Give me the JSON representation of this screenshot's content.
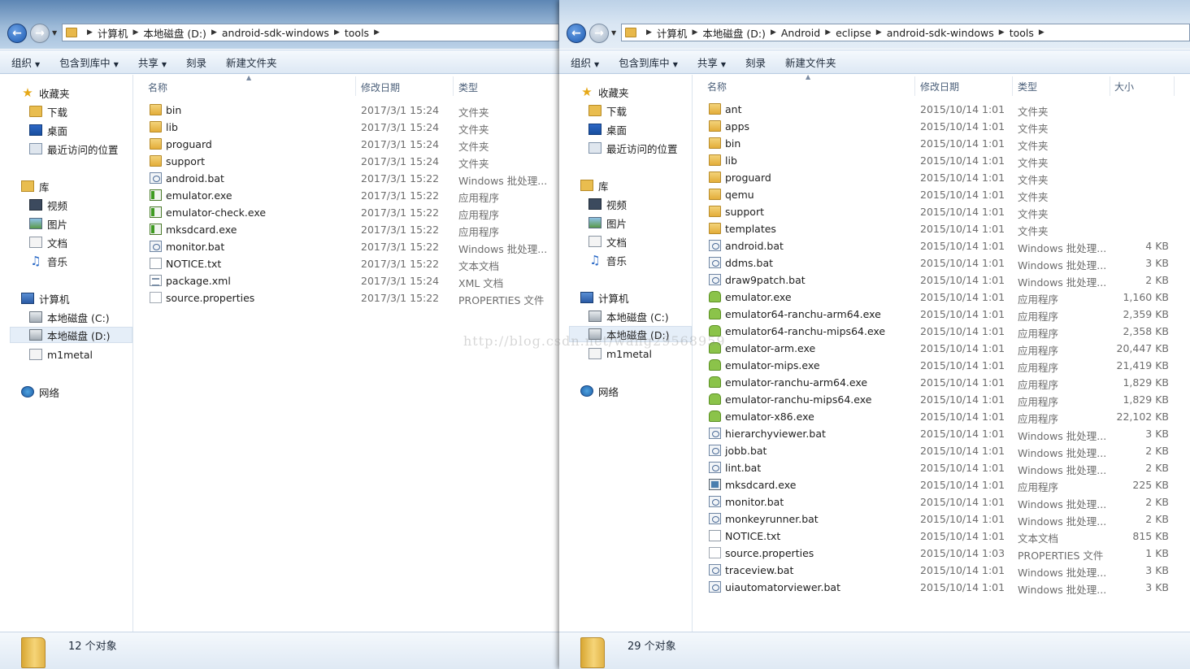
{
  "left": {
    "address": [
      "计算机",
      "本地磁盘 (D:)",
      "android-sdk-windows",
      "tools"
    ],
    "toolbar": {
      "organize": "组织",
      "include_library": "包含到库中",
      "share": "共享",
      "burn": "刻录",
      "new_folder": "新建文件夹"
    },
    "nav": {
      "favorites": "收藏夹",
      "downloads": "下载",
      "desktop": "桌面",
      "recent": "最近访问的位置",
      "libraries": "库",
      "videos": "视频",
      "pictures": "图片",
      "documents": "文档",
      "music": "音乐",
      "computer": "计算机",
      "drive_c": "本地磁盘 (C:)",
      "drive_d": "本地磁盘 (D:)",
      "m1metal": "m1metal",
      "network": "网络"
    },
    "columns": {
      "name": "名称",
      "date": "修改日期",
      "type": "类型"
    },
    "files": [
      {
        "name": "bin",
        "date": "2017/3/1 15:24",
        "type": "文件夹",
        "icon": "folder-icon"
      },
      {
        "name": "lib",
        "date": "2017/3/1 15:24",
        "type": "文件夹",
        "icon": "folder-icon"
      },
      {
        "name": "proguard",
        "date": "2017/3/1 15:24",
        "type": "文件夹",
        "icon": "folder-icon"
      },
      {
        "name": "support",
        "date": "2017/3/1 15:24",
        "type": "文件夹",
        "icon": "folder-icon"
      },
      {
        "name": "android.bat",
        "date": "2017/3/1 15:22",
        "type": "Windows 批处理...",
        "icon": "bat-file-icon"
      },
      {
        "name": "emulator.exe",
        "date": "2017/3/1 15:22",
        "type": "应用程序",
        "icon": "exe-file-icon"
      },
      {
        "name": "emulator-check.exe",
        "date": "2017/3/1 15:22",
        "type": "应用程序",
        "icon": "exe-file-icon"
      },
      {
        "name": "mksdcard.exe",
        "date": "2017/3/1 15:22",
        "type": "应用程序",
        "icon": "exe-file-icon"
      },
      {
        "name": "monitor.bat",
        "date": "2017/3/1 15:22",
        "type": "Windows 批处理...",
        "icon": "bat-file-icon"
      },
      {
        "name": "NOTICE.txt",
        "date": "2017/3/1 15:22",
        "type": "文本文档",
        "icon": "txt-file-icon"
      },
      {
        "name": "package.xml",
        "date": "2017/3/1 15:24",
        "type": "XML 文档",
        "icon": "xml-file-icon"
      },
      {
        "name": "source.properties",
        "date": "2017/3/1 15:22",
        "type": "PROPERTIES 文件",
        "icon": "properties-file-icon"
      }
    ],
    "status": "12 个对象"
  },
  "right": {
    "address": [
      "计算机",
      "本地磁盘 (D:)",
      "Android",
      "eclipse",
      "android-sdk-windows",
      "tools"
    ],
    "toolbar": {
      "organize": "组织",
      "include_library": "包含到库中",
      "share": "共享",
      "burn": "刻录",
      "new_folder": "新建文件夹"
    },
    "nav": {
      "favorites": "收藏夹",
      "downloads": "下载",
      "desktop": "桌面",
      "recent": "最近访问的位置",
      "libraries": "库",
      "videos": "视频",
      "pictures": "图片",
      "documents": "文档",
      "music": "音乐",
      "computer": "计算机",
      "drive_c": "本地磁盘 (C:)",
      "drive_d": "本地磁盘 (D:)",
      "m1metal": "m1metal",
      "network": "网络"
    },
    "columns": {
      "name": "名称",
      "date": "修改日期",
      "type": "类型",
      "size": "大小"
    },
    "files": [
      {
        "name": "ant",
        "date": "2015/10/14 1:01",
        "type": "文件夹",
        "size": "",
        "icon": "folder-icon"
      },
      {
        "name": "apps",
        "date": "2015/10/14 1:01",
        "type": "文件夹",
        "size": "",
        "icon": "folder-icon"
      },
      {
        "name": "bin",
        "date": "2015/10/14 1:01",
        "type": "文件夹",
        "size": "",
        "icon": "folder-icon"
      },
      {
        "name": "lib",
        "date": "2015/10/14 1:01",
        "type": "文件夹",
        "size": "",
        "icon": "folder-icon"
      },
      {
        "name": "proguard",
        "date": "2015/10/14 1:01",
        "type": "文件夹",
        "size": "",
        "icon": "folder-icon"
      },
      {
        "name": "qemu",
        "date": "2015/10/14 1:01",
        "type": "文件夹",
        "size": "",
        "icon": "folder-icon"
      },
      {
        "name": "support",
        "date": "2015/10/14 1:01",
        "type": "文件夹",
        "size": "",
        "icon": "folder-icon"
      },
      {
        "name": "templates",
        "date": "2015/10/14 1:01",
        "type": "文件夹",
        "size": "",
        "icon": "folder-icon"
      },
      {
        "name": "android.bat",
        "date": "2015/10/14 1:01",
        "type": "Windows 批处理...",
        "size": "4 KB",
        "icon": "bat-file-icon"
      },
      {
        "name": "ddms.bat",
        "date": "2015/10/14 1:01",
        "type": "Windows 批处理...",
        "size": "3 KB",
        "icon": "bat-file-icon"
      },
      {
        "name": "draw9patch.bat",
        "date": "2015/10/14 1:01",
        "type": "Windows 批处理...",
        "size": "2 KB",
        "icon": "bat-file-icon"
      },
      {
        "name": "emulator.exe",
        "date": "2015/10/14 1:01",
        "type": "应用程序",
        "size": "1,160 KB",
        "icon": "android-exe-icon"
      },
      {
        "name": "emulator64-ranchu-arm64.exe",
        "date": "2015/10/14 1:01",
        "type": "应用程序",
        "size": "2,359 KB",
        "icon": "android-exe-icon"
      },
      {
        "name": "emulator64-ranchu-mips64.exe",
        "date": "2015/10/14 1:01",
        "type": "应用程序",
        "size": "2,358 KB",
        "icon": "android-exe-icon"
      },
      {
        "name": "emulator-arm.exe",
        "date": "2015/10/14 1:01",
        "type": "应用程序",
        "size": "20,447 KB",
        "icon": "android-exe-icon"
      },
      {
        "name": "emulator-mips.exe",
        "date": "2015/10/14 1:01",
        "type": "应用程序",
        "size": "21,419 KB",
        "icon": "android-exe-icon"
      },
      {
        "name": "emulator-ranchu-arm64.exe",
        "date": "2015/10/14 1:01",
        "type": "应用程序",
        "size": "1,829 KB",
        "icon": "android-exe-icon"
      },
      {
        "name": "emulator-ranchu-mips64.exe",
        "date": "2015/10/14 1:01",
        "type": "应用程序",
        "size": "1,829 KB",
        "icon": "android-exe-icon"
      },
      {
        "name": "emulator-x86.exe",
        "date": "2015/10/14 1:01",
        "type": "应用程序",
        "size": "22,102 KB",
        "icon": "android-exe-icon"
      },
      {
        "name": "hierarchyviewer.bat",
        "date": "2015/10/14 1:01",
        "type": "Windows 批处理...",
        "size": "3 KB",
        "icon": "bat-file-icon"
      },
      {
        "name": "jobb.bat",
        "date": "2015/10/14 1:01",
        "type": "Windows 批处理...",
        "size": "2 KB",
        "icon": "bat-file-icon"
      },
      {
        "name": "lint.bat",
        "date": "2015/10/14 1:01",
        "type": "Windows 批处理...",
        "size": "2 KB",
        "icon": "bat-file-icon"
      },
      {
        "name": "mksdcard.exe",
        "date": "2015/10/14 1:01",
        "type": "应用程序",
        "size": "225 KB",
        "icon": "mksdcard-exe-icon"
      },
      {
        "name": "monitor.bat",
        "date": "2015/10/14 1:01",
        "type": "Windows 批处理...",
        "size": "2 KB",
        "icon": "bat-file-icon"
      },
      {
        "name": "monkeyrunner.bat",
        "date": "2015/10/14 1:01",
        "type": "Windows 批处理...",
        "size": "2 KB",
        "icon": "bat-file-icon"
      },
      {
        "name": "NOTICE.txt",
        "date": "2015/10/14 1:01",
        "type": "文本文档",
        "size": "815 KB",
        "icon": "txt-file-icon"
      },
      {
        "name": "source.properties",
        "date": "2015/10/14 1:03",
        "type": "PROPERTIES 文件",
        "size": "1 KB",
        "icon": "properties-file-icon"
      },
      {
        "name": "traceview.bat",
        "date": "2015/10/14 1:01",
        "type": "Windows 批处理...",
        "size": "3 KB",
        "icon": "bat-file-icon"
      },
      {
        "name": "uiautomatorviewer.bat",
        "date": "2015/10/14 1:01",
        "type": "Windows 批处理...",
        "size": "3 KB",
        "icon": "bat-file-icon"
      }
    ],
    "status": "29 个对象"
  },
  "watermark": "http://blog.csdn.net/wang29568959"
}
